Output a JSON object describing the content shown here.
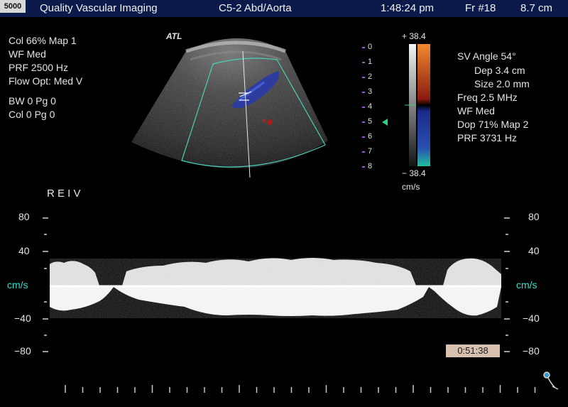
{
  "header": {
    "system_badge": "5000",
    "institution": "Quality Vascular Imaging",
    "preset": "C5-2 Abd/Aorta",
    "time": "1:48:24 pm",
    "frame": "Fr #18",
    "depth": "8.7 cm"
  },
  "color_settings": {
    "line1": "Col 66%  Map 1",
    "line2": "WF Med",
    "line3": "PRF 2500  Hz",
    "line4": "Flow Opt: Med V",
    "line5": "BW 0    Pg 0",
    "line6": "Col 0    Pg 0"
  },
  "logo": "ATL",
  "depth_scale": {
    "labels": [
      "0",
      "1",
      "2",
      "3",
      "4",
      "5",
      "6",
      "7",
      "8"
    ]
  },
  "color_bar": {
    "top_value": "+ 38.4",
    "bottom_value": "− 38.4",
    "unit": "cm/s",
    "positive_color": "#d04a10",
    "negative_color": "#2a3aa0"
  },
  "doppler_settings": {
    "line1": "SV Angle 54°",
    "line2": "Dep 3.4  cm",
    "line3": "Size 2.0  mm",
    "line4": "Freq 2.5  MHz",
    "line5": "WF Med",
    "line6": "Dop 71%  Map 2",
    "line7": "PRF 3731  Hz"
  },
  "spectral": {
    "vessel_label": "R E I V",
    "left_axis": [
      "80",
      "40",
      "cm/s",
      "−40",
      "−80"
    ],
    "right_axis": [
      "80",
      "40",
      "cm/s",
      "−40",
      "−80"
    ],
    "elapsed": "0:51:38"
  }
}
